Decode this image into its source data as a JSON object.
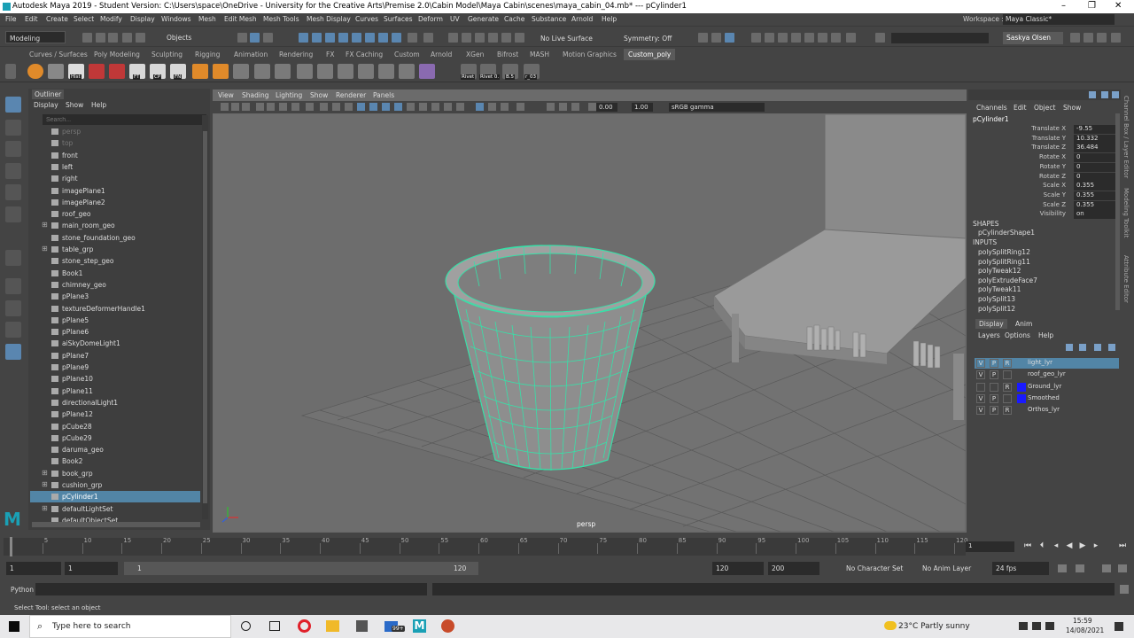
{
  "window": {
    "title": "Autodesk Maya 2019 - Student Version: C:\\Users\\space\\OneDrive - University for the Creative Arts\\Premise 2.0\\Cabin Model\\Maya Cabin\\scenes\\maya_cabin_04.mb*   ---   pCylinder1",
    "controls": [
      "–",
      "❐",
      "✕"
    ]
  },
  "menu": [
    "File",
    "Edit",
    "Create",
    "Select",
    "Modify",
    "Display",
    "Windows",
    "Mesh",
    "Edit Mesh",
    "Mesh Tools",
    "Mesh Display",
    "Curves",
    "Surfaces",
    "Deform",
    "UV",
    "Generate",
    "Cache",
    "Substance",
    "Arnold",
    "Help"
  ],
  "workspace": {
    "label": "Workspace :",
    "value": "Maya Classic*"
  },
  "status_line": {
    "mode": "Modeling",
    "select_by": "Objects",
    "live_surface": "No Live Surface",
    "symmetry": "Symmetry: Off",
    "user": "Saskya Olsen"
  },
  "shelf_tabs": [
    "Curves / Surfaces",
    "Poly Modeling",
    "Sculpting",
    "Rigging",
    "Animation",
    "Rendering",
    "FX",
    "FX Caching",
    "Custom",
    "Arnold",
    "XGen",
    "Bifrost",
    "MASH",
    "Motion Graphics",
    "Custom_poly"
  ],
  "shelf_tab_active": "Custom_poly",
  "shelf_labels": [
    "Hist",
    "FT",
    "CP",
    "FN",
    "Rivet",
    "Rivet 0.",
    "B.5",
    "r_03"
  ],
  "outliner": {
    "title": "Outliner",
    "menu": [
      "Display",
      "Show",
      "Help"
    ],
    "search_placeholder": "Search...",
    "items": [
      {
        "name": "persp",
        "dim": true,
        "expand": false
      },
      {
        "name": "top",
        "dim": true,
        "expand": false
      },
      {
        "name": "front",
        "dim": false,
        "expand": false
      },
      {
        "name": "left",
        "dim": false,
        "expand": false
      },
      {
        "name": "right",
        "dim": false,
        "expand": false
      },
      {
        "name": "imagePlane1",
        "dim": false,
        "expand": false
      },
      {
        "name": "imagePlane2",
        "dim": false,
        "expand": false
      },
      {
        "name": "roof_geo",
        "dim": false,
        "expand": false
      },
      {
        "name": "main_room_geo",
        "dim": false,
        "expand": true
      },
      {
        "name": "stone_foundation_geo",
        "dim": false,
        "expand": false
      },
      {
        "name": "table_grp",
        "dim": false,
        "expand": true
      },
      {
        "name": "stone_step_geo",
        "dim": false,
        "expand": false
      },
      {
        "name": "Book1",
        "dim": false,
        "expand": false
      },
      {
        "name": "chimney_geo",
        "dim": false,
        "expand": false
      },
      {
        "name": "pPlane3",
        "dim": false,
        "expand": false
      },
      {
        "name": "textureDeformerHandle1",
        "dim": false,
        "expand": false
      },
      {
        "name": "pPlane5",
        "dim": false,
        "expand": false
      },
      {
        "name": "pPlane6",
        "dim": false,
        "expand": false
      },
      {
        "name": "aiSkyDomeLight1",
        "dim": false,
        "expand": false
      },
      {
        "name": "pPlane7",
        "dim": false,
        "expand": false
      },
      {
        "name": "pPlane9",
        "dim": false,
        "expand": false
      },
      {
        "name": "pPlane10",
        "dim": false,
        "expand": false
      },
      {
        "name": "pPlane11",
        "dim": false,
        "expand": false
      },
      {
        "name": "directionalLight1",
        "dim": false,
        "expand": false
      },
      {
        "name": "pPlane12",
        "dim": false,
        "expand": false
      },
      {
        "name": "pCube28",
        "dim": false,
        "expand": false
      },
      {
        "name": "pCube29",
        "dim": false,
        "expand": false
      },
      {
        "name": "daruma_geo",
        "dim": false,
        "expand": false
      },
      {
        "name": "Book2",
        "dim": false,
        "expand": false
      },
      {
        "name": "book_grp",
        "dim": false,
        "expand": true
      },
      {
        "name": "cushion_grp",
        "dim": false,
        "expand": true
      },
      {
        "name": "pCylinder1",
        "dim": false,
        "expand": false,
        "selected": true
      },
      {
        "name": "defaultLightSet",
        "dim": false,
        "expand": true
      },
      {
        "name": "defaultObjectSet",
        "dim": false,
        "expand": false
      }
    ]
  },
  "viewport": {
    "menu": [
      "View",
      "Shading",
      "Lighting",
      "Show",
      "Renderer",
      "Panels"
    ],
    "exposure": "0.00",
    "gamma": "1.00",
    "color_space": "sRGB gamma",
    "camera_label": "persp"
  },
  "channel_box": {
    "menu": [
      "Channels",
      "Edit",
      "Object",
      "Show"
    ],
    "object": "pCylinder1",
    "attributes": [
      {
        "name": "Translate X",
        "value": "-9.55"
      },
      {
        "name": "Translate Y",
        "value": "10.332"
      },
      {
        "name": "Translate Z",
        "value": "36.484"
      },
      {
        "name": "Rotate X",
        "value": "0"
      },
      {
        "name": "Rotate Y",
        "value": "0"
      },
      {
        "name": "Rotate Z",
        "value": "0"
      },
      {
        "name": "Scale X",
        "value": "0.355"
      },
      {
        "name": "Scale Y",
        "value": "0.355"
      },
      {
        "name": "Scale Z",
        "value": "0.355"
      },
      {
        "name": "Visibility",
        "value": "on"
      }
    ],
    "shapes_header": "SHAPES",
    "shape": "pCylinderShape1",
    "inputs_header": "INPUTS",
    "inputs": [
      "polySplitRing12",
      "polySplitRing11",
      "polyTweak12",
      "polyExtrudeFace7",
      "polyTweak11",
      "polySplit13",
      "polySplit12"
    ]
  },
  "side_tabs": [
    "Channel Box / Layer Editor",
    "Modeling Toolkit",
    "Attribute Editor"
  ],
  "layer_editor": {
    "tabs": [
      "Display",
      "Anim"
    ],
    "menu": [
      "Layers",
      "Options",
      "Help"
    ],
    "layers": [
      {
        "v": "V",
        "p": "P",
        "r": "R",
        "name": "light_lyr",
        "color": "",
        "selected": true
      },
      {
        "v": "V",
        "p": "P",
        "r": "",
        "name": "roof_geo_lyr",
        "color": "",
        "selected": false
      },
      {
        "v": "",
        "p": "",
        "r": "R",
        "name": "Ground_lyr",
        "color": "#1a1aff",
        "selected": false
      },
      {
        "v": "V",
        "p": "P",
        "r": "",
        "name": "Smoothed",
        "color": "#1a1aff",
        "selected": false
      },
      {
        "v": "V",
        "p": "P",
        "r": "R",
        "name": "Orthos_lyr",
        "color": "",
        "selected": false
      }
    ]
  },
  "timeline": {
    "ticks": [
      "5",
      "10",
      "15",
      "20",
      "25",
      "30",
      "35",
      "40",
      "45",
      "50",
      "55",
      "60",
      "65",
      "70",
      "75",
      "80",
      "85",
      "90",
      "95",
      "100",
      "105",
      "110",
      "115",
      "120"
    ],
    "current_frame": "1"
  },
  "range": {
    "start": "1",
    "anim_start": "1",
    "slider_start": "1",
    "slider_end": "120",
    "end": "120",
    "anim_end": "200",
    "character_set": "No Character Set",
    "anim_layer": "No Anim Layer",
    "fps": "24 fps"
  },
  "command_line": {
    "label": "Python"
  },
  "help_line": "Select Tool: select an object",
  "taskbar": {
    "search_placeholder": "Type here to search",
    "badge": "99+",
    "weather": "23°C  Partly sunny",
    "time": "15:59",
    "date": "14/08/2021"
  }
}
